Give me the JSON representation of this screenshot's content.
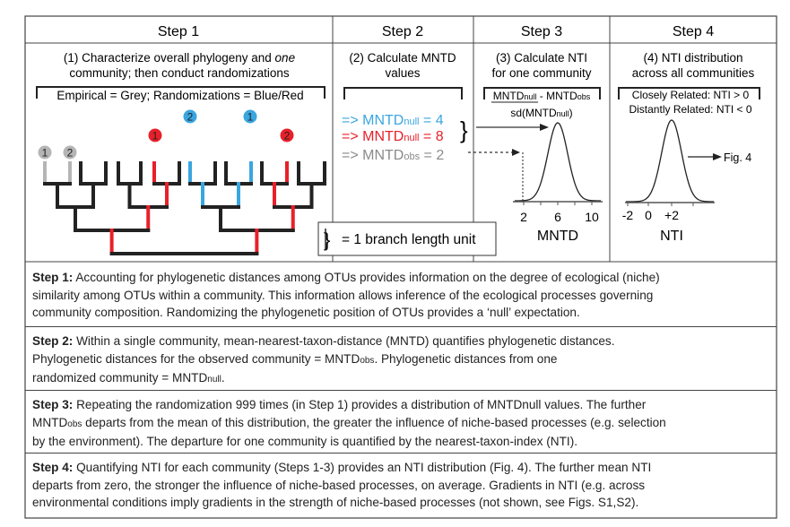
{
  "header": {
    "steps": [
      "Step 1",
      "Step 2",
      "Step 3",
      "Step 4"
    ]
  },
  "step1": {
    "title_lines": [
      "(1) Characterize overall phylogeny and ",
      "one",
      "community; then conduct randomizations"
    ],
    "legend": "Empirical = Grey; Randomizations = Blue/Red",
    "markers": [
      {
        "label": "1",
        "color": "grey"
      },
      {
        "label": "2",
        "color": "grey"
      },
      {
        "label": "1",
        "color": "red"
      },
      {
        "label": "2",
        "color": "blue"
      },
      {
        "label": "1",
        "color": "blue"
      },
      {
        "label": "2",
        "color": "red"
      }
    ],
    "scale_label": "= 1 branch length unit"
  },
  "step2": {
    "title_lines": [
      "(2) Calculate MNTD",
      "values"
    ],
    "values": [
      {
        "prefix": "=> MNTD",
        "sub": "null",
        "suffix": " = 4",
        "color": "#3aa6e0"
      },
      {
        "prefix": "=> MNTD",
        "sub": "null",
        "suffix": " = 8",
        "color": "#e8202a"
      },
      {
        "prefix": "=> MNTD",
        "sub": "obs",
        "suffix": " = 2",
        "color": "#8a8a8a"
      }
    ]
  },
  "step3": {
    "title_lines": [
      "(3) Calculate NTI",
      "for one community"
    ],
    "formula": {
      "num_a": "MNTD",
      "num_a_sub": "null",
      "num_mid": " - MNTD",
      "num_b_sub": "obs",
      "den_a": "sd(MNTD",
      "den_sub": "null",
      "den_b": ")"
    },
    "ticks": [
      "2",
      "6",
      "10"
    ],
    "xlabel": "MNTD"
  },
  "step4": {
    "title_lines": [
      "(4) NTI distribution",
      "across all communities"
    ],
    "rules": [
      "Closely Related: NTI > 0",
      "Distantly Related: NTI < 0"
    ],
    "ticks": [
      "-2",
      "0",
      "+2"
    ],
    "xlabel": "NTI",
    "arrow_label": "Fig. 4"
  },
  "descriptions": [
    {
      "label": "Step 1:",
      "lines": [
        "  Accounting for phylogenetic distances among OTUs provides information on the degree of ecological (niche)",
        "similarity among OTUs within a community. This information allows inference of the ecological processes governing",
        "community composition. Randomizing the phylogenetic position of OTUs provides a ‘null’ expectation."
      ]
    },
    {
      "label": "Step 2:",
      "lines": [
        " Within a single community, mean-nearest-taxon-distance (MNTD) quantifies phylogenetic distances.",
        "Phylogenetic distances for the observed community = MNTD|obs|. Phylogenetic distances from one",
        "randomized community = MNTD|null|."
      ]
    },
    {
      "label": "Step 3:",
      "lines": [
        "  Repeating the randomization 999 times (in Step 1) provides a distribution of MNTDnull values. The further",
        "MNTD|obs| departs from the mean of this distribution, the greater the influence of niche-based processes (e.g. selection",
        "by the environment). The departure for one community is quantified by the nearest-taxon-index (NTI)."
      ]
    },
    {
      "label": "Step 4:",
      "lines": [
        "  Quantifying NTI for each community (Steps 1-3) provides an NTI distribution (Fig. 4). The further mean NTI",
        "departs from zero, the stronger the influence of niche-based processes, on average. Gradients in NTI (e.g. across",
        "environmental conditions imply gradients in the strength of niche-based processes (not shown, see Figs. S1,S2)."
      ]
    }
  ],
  "colors": {
    "grey": "#b5b5b5",
    "red": "#e8202a",
    "blue": "#3aa6e0",
    "black": "#222222",
    "border": "#444444"
  }
}
